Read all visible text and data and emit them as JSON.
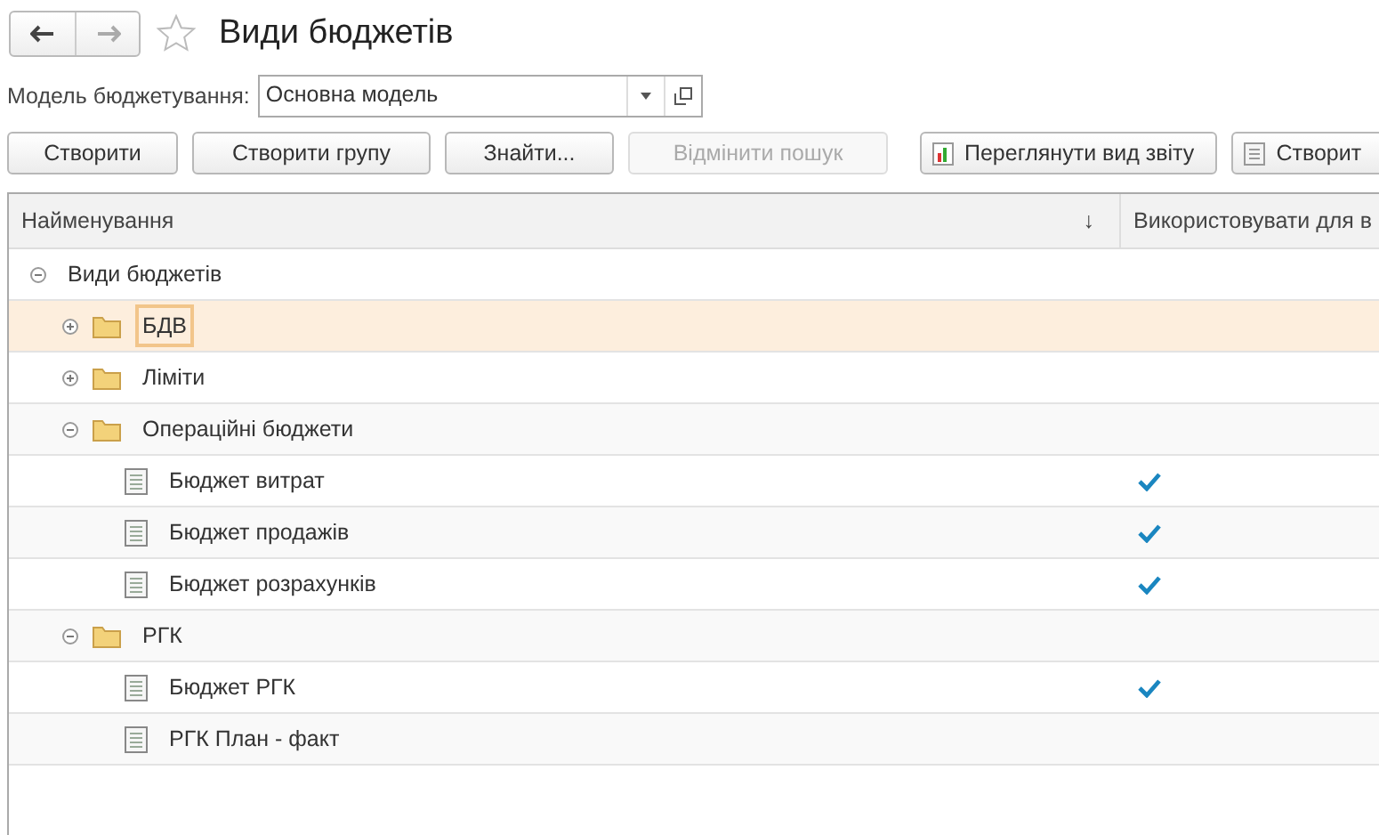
{
  "window": {
    "title": "Види бюджетів",
    "favorite": false
  },
  "filter": {
    "label": "Модель бюджетування:",
    "value": "Основна модель"
  },
  "toolbar": [
    {
      "label": "Створити",
      "kind": "plain",
      "disabled": false
    },
    {
      "label": "Створити групу",
      "kind": "plain",
      "disabled": false
    },
    {
      "label": "Знайти...",
      "kind": "plain",
      "disabled": false
    },
    {
      "label": "Відмінити пошук",
      "kind": "plain",
      "disabled": true
    },
    {
      "label": "Переглянути вид звіту",
      "kind": "report",
      "disabled": false
    },
    {
      "label": "Створит",
      "kind": "document",
      "disabled": false
    }
  ],
  "table": {
    "columns": [
      {
        "label": "Найменування",
        "sort": "↓"
      },
      {
        "label": "Використовувати для в"
      }
    ],
    "tree": [
      {
        "name": "Види бюджетів",
        "kind": "root",
        "expanded": true,
        "selected": false,
        "children": [
          {
            "name": "БДВ",
            "kind": "group",
            "expanded": false,
            "selected": true,
            "checked": false
          },
          {
            "name": "Ліміти",
            "kind": "group",
            "expanded": false,
            "selected": false,
            "checked": false
          },
          {
            "name": "Операційні бюджети",
            "kind": "group",
            "expanded": true,
            "selected": false,
            "checked": false,
            "children": [
              {
                "name": "Бюджет витрат",
                "kind": "item",
                "selected": false,
                "checked": true
              },
              {
                "name": "Бюджет продажів",
                "kind": "item",
                "selected": false,
                "checked": true
              },
              {
                "name": "Бюджет розрахунків",
                "kind": "item",
                "selected": false,
                "checked": true
              }
            ]
          },
          {
            "name": "РГК",
            "kind": "group",
            "expanded": true,
            "selected": false,
            "checked": false,
            "children": [
              {
                "name": "Бюджет РГК",
                "kind": "item",
                "selected": false,
                "checked": true
              },
              {
                "name": "РГК План - факт",
                "kind": "item",
                "selected": false,
                "checked": false
              }
            ]
          }
        ]
      }
    ]
  }
}
